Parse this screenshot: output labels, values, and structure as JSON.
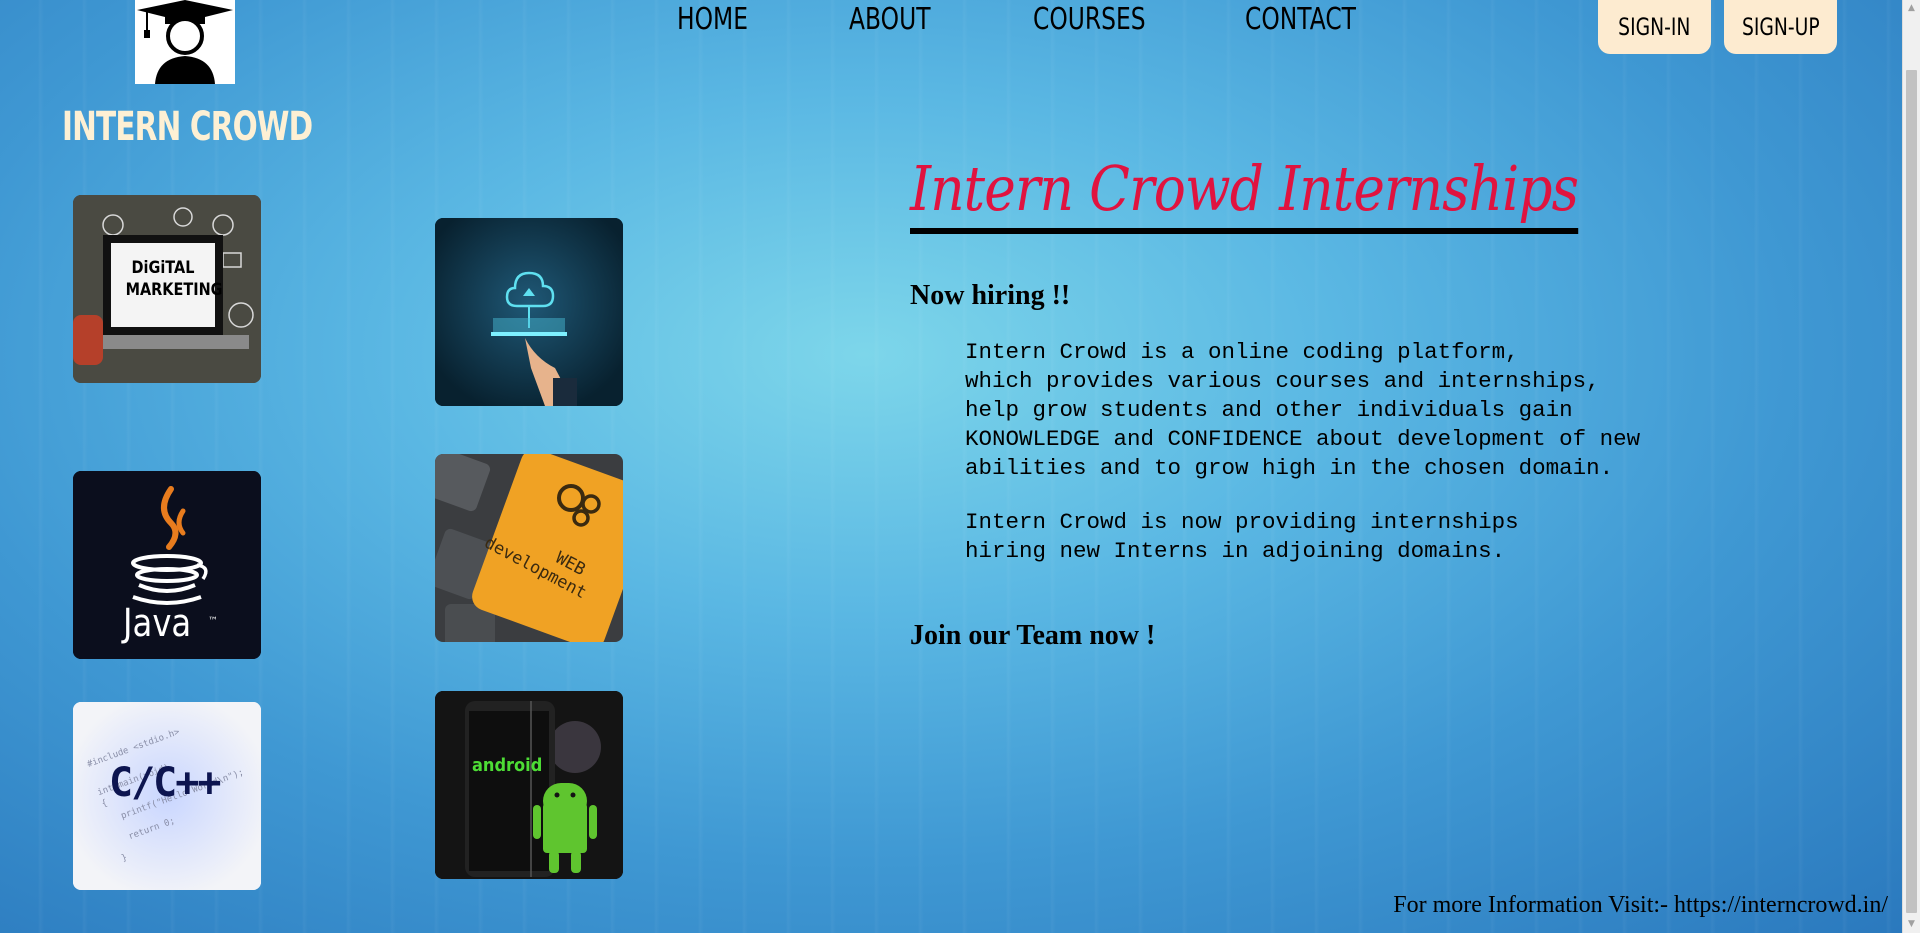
{
  "brand": {
    "name": "INTERN CROWD",
    "logo_icon": "graduate-cap-avatar-icon"
  },
  "nav": {
    "items": [
      {
        "label": "HOME"
      },
      {
        "label": "ABOUT"
      },
      {
        "label": "COURSES"
      },
      {
        "label": "CONTACT"
      }
    ],
    "sign_in": "SIGN-IN",
    "sign_up": "SIGN-UP"
  },
  "courses": {
    "tiles": [
      {
        "name": "digital-marketing",
        "label": "DiGiTAL MARKETING"
      },
      {
        "name": "cloud",
        "label": ""
      },
      {
        "name": "java",
        "label": "Java",
        "tm": "™"
      },
      {
        "name": "web-development",
        "label_line1": "WEB",
        "label_line2": "development"
      },
      {
        "name": "c-cpp",
        "label": "C/C++"
      },
      {
        "name": "android",
        "label": "android"
      }
    ]
  },
  "main": {
    "headline": "Intern Crowd Internships",
    "hiring": "Now hiring !!",
    "paragraph1": "Intern Crowd is a online coding platform,\nwhich provides various courses and internships,\nhelp grow students and other individuals gain\nKONOWLEDGE and CONFIDENCE about development of new\nabilities and to grow high in the chosen domain.",
    "paragraph2": "Intern Crowd is now providing internships\nhiring new Interns in adjoining domains.",
    "join": "Join our Team now !"
  },
  "footer": {
    "text": "For more Information Visit:- https://interncrowd.in/"
  },
  "colors": {
    "headline": "#e0133f",
    "brand": "#fdf0d4",
    "button_bg": "#fdebd0"
  }
}
